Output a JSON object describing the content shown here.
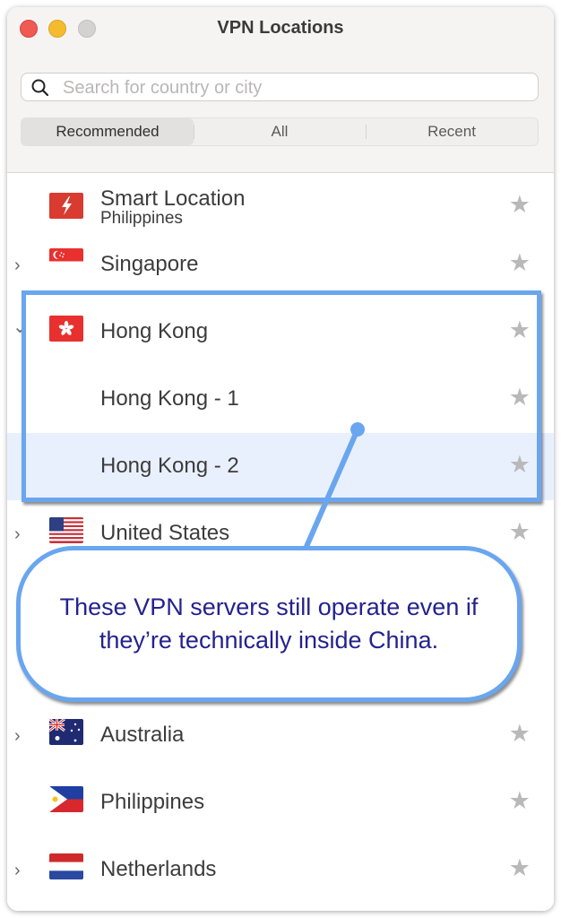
{
  "window": {
    "title": "VPN Locations"
  },
  "search": {
    "placeholder": "Search for country or city"
  },
  "tabs": [
    {
      "label": "Recommended",
      "active": true
    },
    {
      "label": "All",
      "active": false
    },
    {
      "label": "Recent",
      "active": false
    }
  ],
  "locations": [
    {
      "name": "Smart Location",
      "subtitle": "Philippines",
      "flag": "smart-location-bolt-icon"
    },
    {
      "name": "Singapore",
      "flag": "singapore-flag",
      "expandable": true
    },
    {
      "name": "Hong Kong",
      "flag": "hong-kong-flag",
      "expandable": true,
      "expanded": true
    },
    {
      "name": "Hong Kong - 1"
    },
    {
      "name": "Hong Kong - 2",
      "selected": true
    },
    {
      "name": "United States",
      "flag": "usa-flag",
      "expandable": true
    },
    {
      "name": "Australia",
      "flag": "australia-flag",
      "expandable": true
    },
    {
      "name": "Philippines",
      "flag": "philippines-flag"
    },
    {
      "name": "Netherlands",
      "flag": "netherlands-flag",
      "expandable": true
    }
  ],
  "annotation": {
    "text": "These VPN servers still operate even if they’re technically inside China."
  },
  "colors": {
    "highlight": "#6aa6f0",
    "annotation_text": "#24228f",
    "selected_row": "#e9f0fd"
  }
}
